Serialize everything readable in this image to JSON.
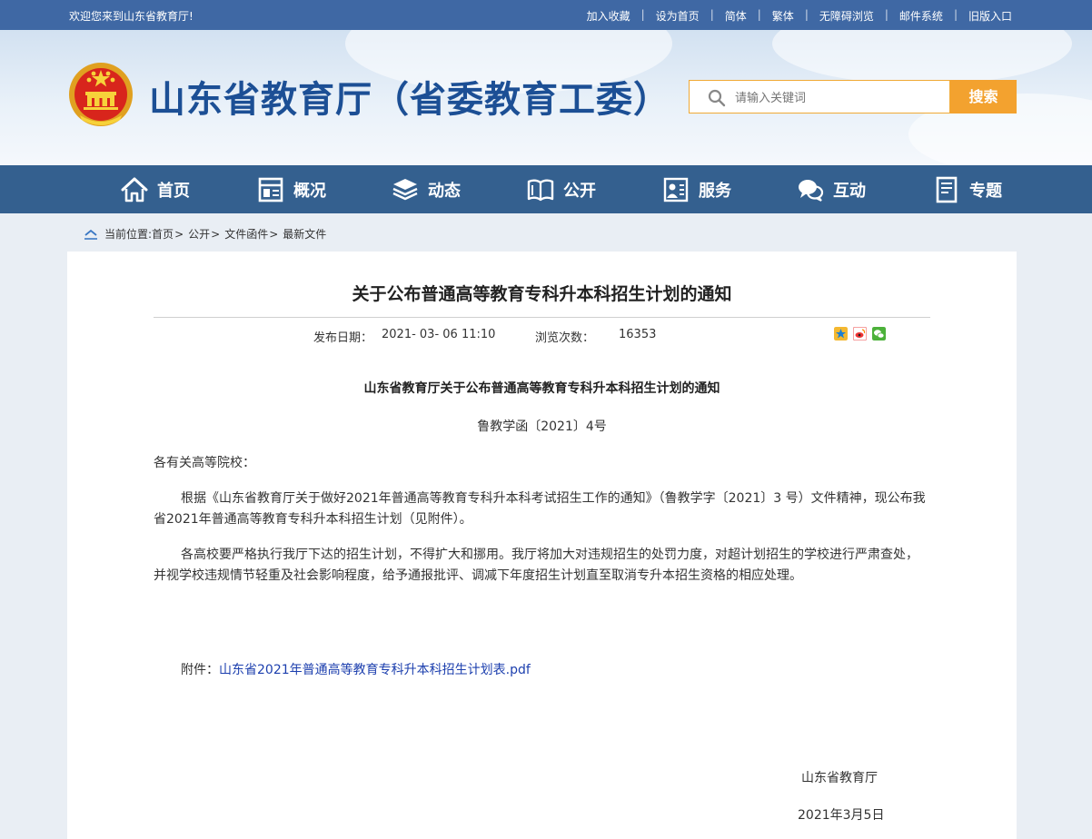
{
  "topbar": {
    "welcome": "欢迎您来到山东省教育厅!",
    "links": [
      "加入收藏",
      "设为首页",
      "简体",
      "繁体",
      "无障碍浏览",
      "邮件系统",
      "旧版入口"
    ],
    "separator": "|"
  },
  "header": {
    "site_title": "山东省教育厅（省委教育工委）",
    "search_placeholder": "请输入关键词",
    "search_button": "搜索"
  },
  "nav": {
    "items": [
      {
        "label": "首页",
        "icon": "home-icon"
      },
      {
        "label": "概况",
        "icon": "overview-icon"
      },
      {
        "label": "动态",
        "icon": "layers-icon"
      },
      {
        "label": "公开",
        "icon": "book-icon"
      },
      {
        "label": "服务",
        "icon": "service-icon"
      },
      {
        "label": "互动",
        "icon": "chat-icon"
      },
      {
        "label": "专题",
        "icon": "document-icon"
      }
    ]
  },
  "breadcrumb": {
    "prefix": "当前位置:",
    "items": [
      "首页",
      "公开",
      "文件函件",
      "最新文件"
    ],
    "arrow": ">"
  },
  "article": {
    "title": "关于公布普通高等教育专科升本科招生计划的通知",
    "date_label": "发布日期：",
    "date_value": "2021- 03- 06 11:10",
    "views_label": "浏览次数：",
    "views_value": "16353",
    "doc_title": "山东省教育厅关于公布普通高等教育专科升本科招生计划的通知",
    "doc_number": "鲁教学函〔2021〕4号",
    "salutation": "各有关高等院校：",
    "paragraphs": [
      "根据《山东省教育厅关于做好2021年普通高等教育专科升本科考试招生工作的通知》（鲁教学字〔2021〕3 号）文件精神，现公布我省2021年普通高等教育专科升本科招生计划（见附件）。",
      "各高校要严格执行我厅下达的招生计划，不得扩大和挪用。我厅将加大对违规招生的处罚力度，对超计划招生的学校进行严肃查处，并视学校违规情节轻重及社会影响程度，给予通报批评、调减下年度招生计划直至取消专升本招生资格的相应处理。"
    ],
    "attachment_label": "附件：",
    "attachment_link": "山东省2021年普通高等教育专科升本科招生计划表.pdf",
    "signature_org": "山东省教育厅",
    "signature_date": "2021年3月5日"
  },
  "colors": {
    "topbar": "#3f68a4",
    "nav": "#34608f",
    "title_blue": "#1c4f95",
    "search_button": "#f3a22f",
    "link": "#1c3fae"
  }
}
